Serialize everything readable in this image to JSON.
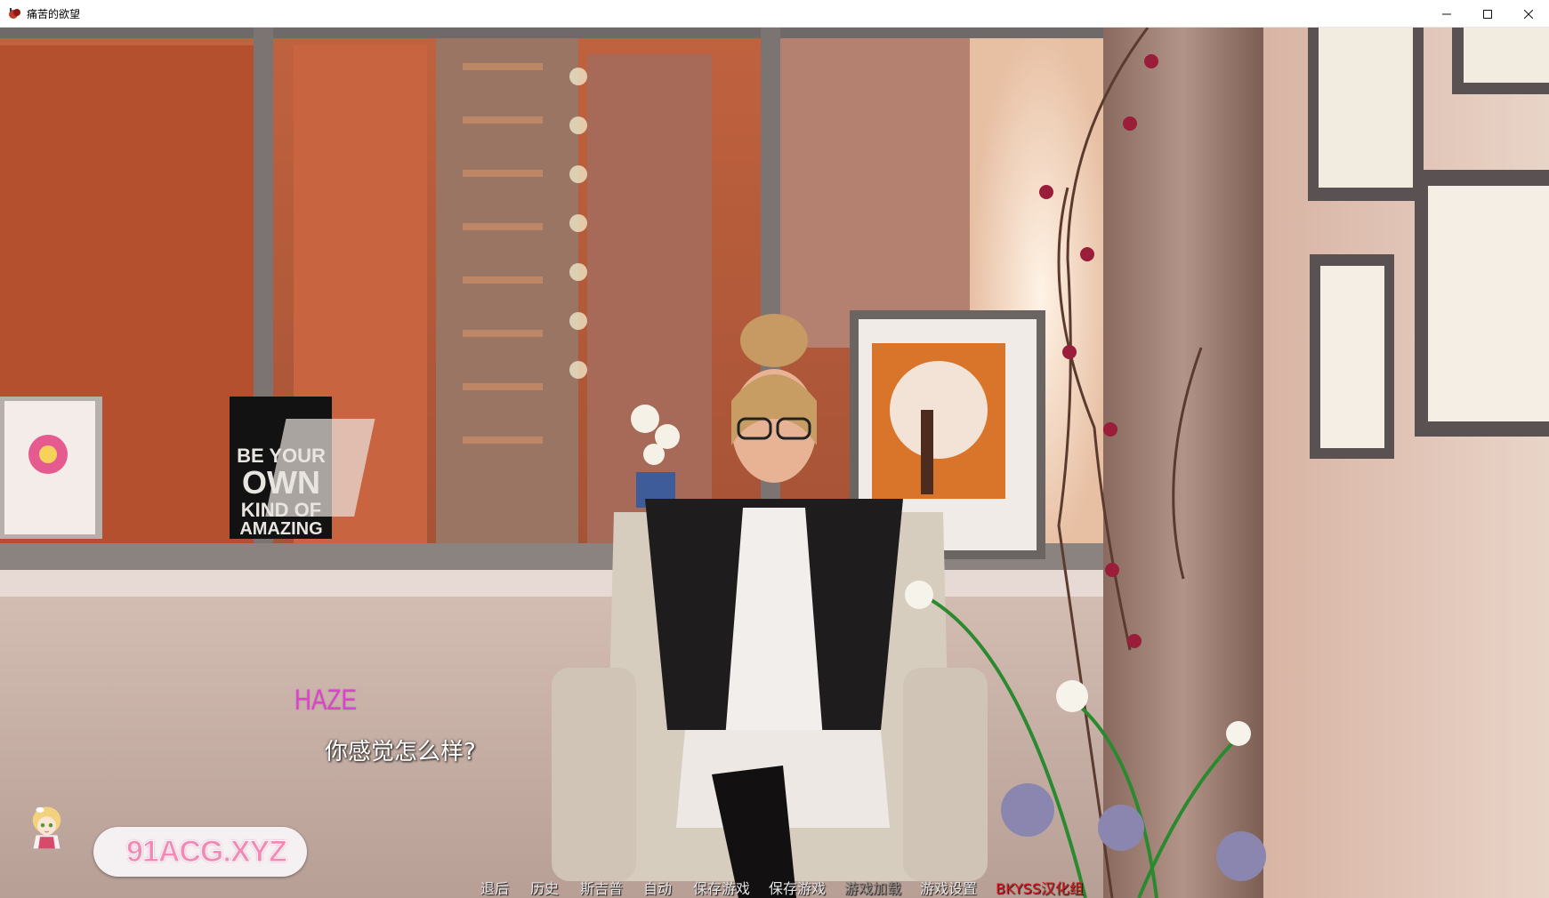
{
  "window": {
    "title": "痛苦的欲望",
    "controls": {
      "minimize_icon": "minimize-icon",
      "maximize_icon": "maximize-icon",
      "close_icon": "close-icon"
    }
  },
  "scene": {
    "poster_text": [
      "BE YOUR",
      "OWN",
      "KIND OF",
      "AMAZING"
    ]
  },
  "dialogue": {
    "speaker": "HAZE",
    "speaker_color": "#e040d0",
    "text": "你感觉怎么样?"
  },
  "quick_menu": {
    "items": [
      {
        "label": "退后",
        "enabled": true
      },
      {
        "label": "历史",
        "enabled": true
      },
      {
        "label": "斯吉普",
        "enabled": true
      },
      {
        "label": "自动",
        "enabled": true
      },
      {
        "label": "保存游戏",
        "enabled": true
      },
      {
        "label": "保存游戏",
        "enabled": true
      },
      {
        "label": "游戏加载",
        "enabled": false
      },
      {
        "label": "游戏设置",
        "enabled": true
      },
      {
        "label": "BKYSS汉化组",
        "enabled": true
      }
    ],
    "credit_color": "#e0161a"
  },
  "watermark": {
    "text": "91ACG.XYZ"
  }
}
